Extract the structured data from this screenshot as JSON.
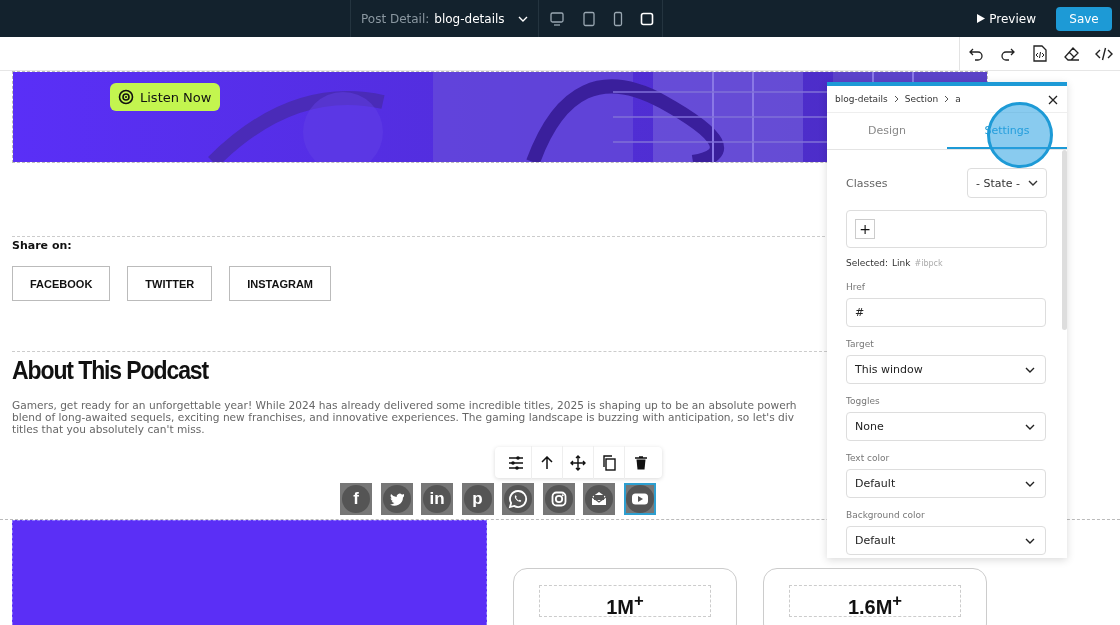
{
  "top_bar": {
    "page_label": "Post Detail:",
    "page_name": "blog-details",
    "devices": [
      {
        "kind": "desktop",
        "selected": false
      },
      {
        "kind": "tablet",
        "selected": false
      },
      {
        "kind": "mobile",
        "selected": false
      },
      {
        "kind": "square",
        "selected": true
      }
    ],
    "preview": "Preview",
    "save": "Save"
  },
  "hero": {
    "button": "Listen Now"
  },
  "share": {
    "label": "Share on:",
    "buttons": [
      "FACEBOOK",
      "TWITTER",
      "INSTAGRAM"
    ]
  },
  "about": {
    "heading": "About This Podcast",
    "lines": [
      "Gamers, get ready for an unforgettable year! While 2024 has already delivered some incredible titles, 2025 is shaping up to be an absolute powerh",
      "blend of long-awaited sequels, exciting new franchises, and innovative experiences. The gaming landscape is buzzing with anticipation, so let's div",
      "titles that you absolutely can't miss."
    ]
  },
  "social_icons": [
    {
      "kind": "glyph",
      "glyph": "f",
      "selected": false
    },
    {
      "kind": "bird",
      "selected": false
    },
    {
      "kind": "glyph",
      "glyph": "in",
      "selected": false
    },
    {
      "kind": "glyph",
      "glyph": "p",
      "selected": false
    },
    {
      "kind": "phone",
      "selected": false
    },
    {
      "kind": "camera",
      "selected": false
    },
    {
      "kind": "envelope",
      "selected": false
    },
    {
      "kind": "play",
      "selected": true
    }
  ],
  "stats": [
    "1M$^{+}$",
    "1.6M$^{+}$"
  ],
  "panel": {
    "breadcrumb": [
      "blog-details",
      "Section",
      "a"
    ],
    "tabs": [
      {
        "label": "Design",
        "selected": false
      },
      {
        "label": "Settings",
        "selected": true
      }
    ],
    "classes_label": "Classes",
    "state_select": "- State -",
    "add_class": "+",
    "selected_label": "Selected:",
    "selected_name": "Link",
    "selected_id": "#ibpck",
    "fields": [
      {
        "label": "Href",
        "kind": "input",
        "value": "#"
      },
      {
        "label": "Target",
        "kind": "select",
        "value": "This window"
      },
      {
        "label": "Toggles",
        "kind": "select",
        "value": "None"
      },
      {
        "label": "Text color",
        "kind": "select",
        "value": "Default"
      },
      {
        "label": "Background color",
        "kind": "select",
        "value": "Default"
      }
    ]
  }
}
